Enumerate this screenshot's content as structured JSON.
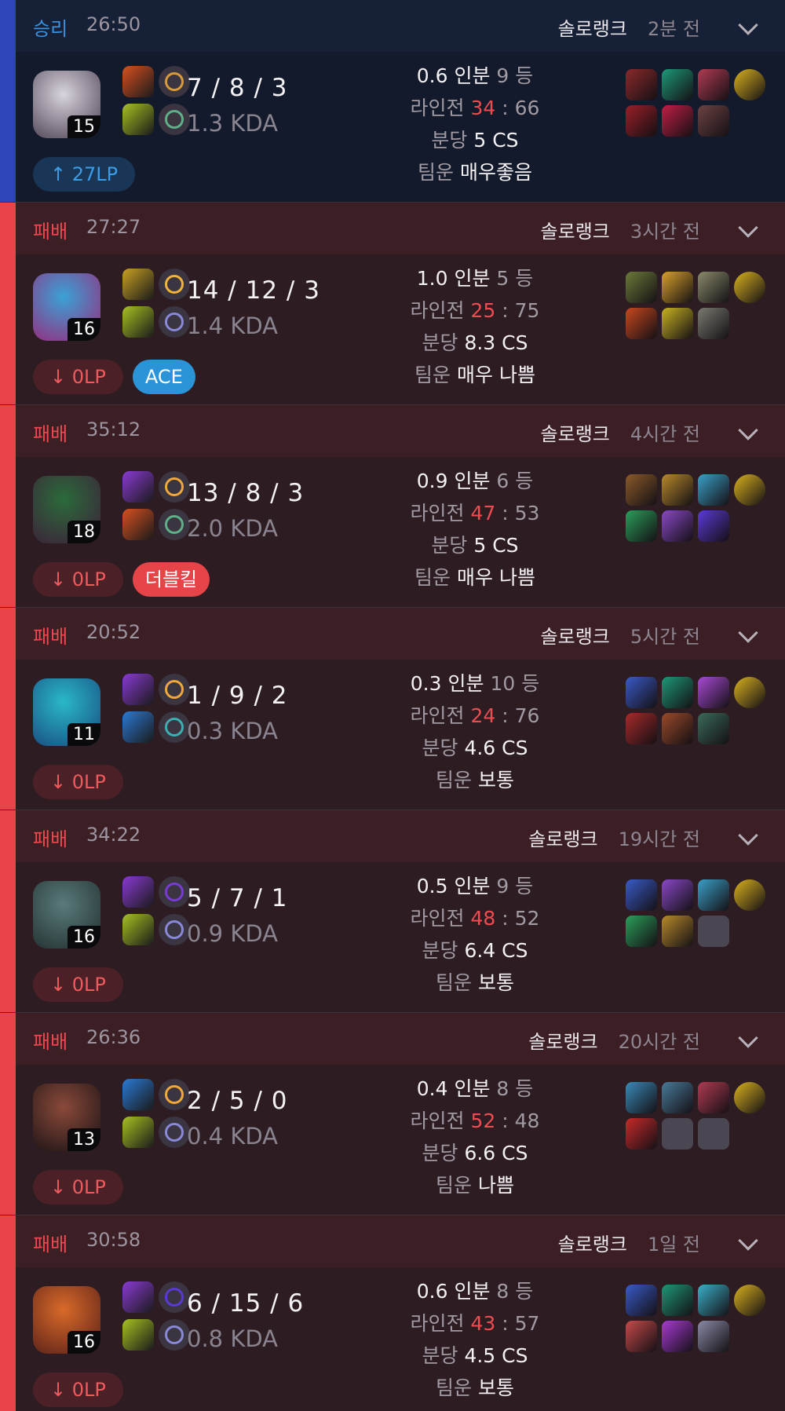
{
  "labels": {
    "kill_part_suffix": "인분",
    "rank_suffix": "등",
    "lane": "라인전",
    "cs_prefix": "분당",
    "cs_suffix": "CS",
    "luck": "팀운",
    "kda_suffix": "KDA"
  },
  "matches": [
    {
      "result": "승리",
      "outcome": "win",
      "duration": "26:50",
      "queue": "솔로랭크",
      "ago": "2분 전",
      "level": "15",
      "kda": "7 / 8 / 3",
      "kda_ratio": "1.3 KDA",
      "lp": "↑ 27LP",
      "tag": "",
      "kp": "0.6",
      "rank": "9",
      "lane_a": "34",
      "lane_b": "66",
      "cs": "5",
      "luck": "매우좋음",
      "champ_colors": [
        "#d9d4dd",
        "#5f5666"
      ],
      "spells": [
        "#d9501f",
        "#a7c221"
      ],
      "runes": [
        "#d99a3a",
        "#5fb088"
      ],
      "items": [
        "#8c2a2a",
        "#1d9978",
        "#b23b52",
        "#d9b21f",
        "#9a1f26",
        "#c21f45",
        "#6e4242"
      ]
    },
    {
      "result": "패배",
      "outcome": "loss",
      "duration": "27:27",
      "queue": "솔로랭크",
      "ago": "3시간 전",
      "level": "16",
      "kda": "14 / 12 / 3",
      "kda_ratio": "1.4 KDA",
      "lp": "↓ 0LP",
      "tag": "ACE",
      "kp": "1.0",
      "rank": "5",
      "lane_a": "25",
      "lane_b": "75",
      "cs": "8.3",
      "luck": "매우 나쁨",
      "champ_colors": [
        "#3aa2d6",
        "#8c3a88"
      ],
      "spells": [
        "#c9a221",
        "#a7c221"
      ],
      "runes": [
        "#f0b43b",
        "#8a88d8"
      ],
      "items": [
        "#6c7a3a",
        "#d9a22a",
        "#8a8a6a",
        "#d9b21f",
        "#c9471f",
        "#c9b221",
        "#7a7a70"
      ]
    },
    {
      "result": "패배",
      "outcome": "loss",
      "duration": "35:12",
      "queue": "솔로랭크",
      "ago": "4시간 전",
      "level": "18",
      "kda": "13 / 8 / 3",
      "kda_ratio": "2.0 KDA",
      "lp": "↓ 0LP",
      "tag": "더블킬",
      "kp": "0.9",
      "rank": "6",
      "lane_a": "47",
      "lane_b": "53",
      "cs": "5",
      "luck": "매우 나쁨",
      "champ_colors": [
        "#2b6b3a",
        "#3a2a3a"
      ],
      "spells": [
        "#8a3ad6",
        "#d9501f"
      ],
      "runes": [
        "#f0a83b",
        "#5fb088"
      ],
      "items": [
        "#8a5a2a",
        "#b88a2a",
        "#3aa0c8",
        "#d9b21f",
        "#2aa05a",
        "#8a48c8",
        "#5a3ad6"
      ]
    },
    {
      "result": "패배",
      "outcome": "loss",
      "duration": "20:52",
      "queue": "솔로랭크",
      "ago": "5시간 전",
      "level": "11",
      "kda": "1 / 9 / 2",
      "kda_ratio": "0.3 KDA",
      "lp": "↓ 0LP",
      "tag": "",
      "kp": "0.3",
      "rank": "10",
      "lane_a": "24",
      "lane_b": "76",
      "cs": "4.6",
      "luck": "보통",
      "champ_colors": [
        "#2ab8c8",
        "#1a5a8a"
      ],
      "spells": [
        "#8a3ad6",
        "#2a7ad6"
      ],
      "runes": [
        "#f0a83b",
        "#3ab0b0"
      ],
      "items": [
        "#3a5ac8",
        "#1d9978",
        "#a84ad6",
        "#d9b21f",
        "#a82a2a",
        "#9a4a2a",
        "#3a6a5a"
      ]
    },
    {
      "result": "패배",
      "outcome": "loss",
      "duration": "34:22",
      "queue": "솔로랭크",
      "ago": "19시간 전",
      "level": "16",
      "kda": "5 / 7 / 1",
      "kda_ratio": "0.9 KDA",
      "lp": "↓ 0LP",
      "tag": "",
      "kp": "0.5",
      "rank": "9",
      "lane_a": "48",
      "lane_b": "52",
      "cs": "6.4",
      "luck": "보통",
      "champ_colors": [
        "#5a7a7a",
        "#2a3a3a"
      ],
      "spells": [
        "#8a3ad6",
        "#a7c221"
      ],
      "runes": [
        "#7a3ad6",
        "#8a88d8"
      ],
      "items": [
        "#3a5ac8",
        "#8a48c8",
        "#3aa0c8",
        "#d9b21f",
        "#2aa05a",
        "#b88a2a",
        ""
      ]
    },
    {
      "result": "패배",
      "outcome": "loss",
      "duration": "26:36",
      "queue": "솔로랭크",
      "ago": "20시간 전",
      "level": "13",
      "kda": "2 / 5 / 0",
      "kda_ratio": "0.4 KDA",
      "lp": "↓ 0LP",
      "tag": "",
      "kp": "0.4",
      "rank": "8",
      "lane_a": "52",
      "lane_b": "48",
      "cs": "6.6",
      "luck": "나쁨",
      "champ_colors": [
        "#8a4a3a",
        "#2a1a1a"
      ],
      "spells": [
        "#2a7ad6",
        "#a7c221"
      ],
      "runes": [
        "#f0a83b",
        "#8a88d8"
      ],
      "items": [
        "#3a8ab8",
        "#4a7a9a",
        "#b23b52",
        "#d9b21f",
        "#c82a2a",
        "",
        ""
      ]
    },
    {
      "result": "패배",
      "outcome": "loss",
      "duration": "30:58",
      "queue": "솔로랭크",
      "ago": "1일 전",
      "level": "16",
      "kda": "6 / 15 / 6",
      "kda_ratio": "0.8 KDA",
      "lp": "↓ 0LP",
      "tag": "",
      "kp": "0.6",
      "rank": "8",
      "lane_a": "43",
      "lane_b": "57",
      "cs": "4.5",
      "luck": "보통",
      "champ_colors": [
        "#d96a2a",
        "#6a2a1a"
      ],
      "spells": [
        "#8a3ad6",
        "#a7c221"
      ],
      "runes": [
        "#5a3ad6",
        "#8a88d8"
      ],
      "items": [
        "#3a5ac8",
        "#1d9978",
        "#3ab0c8",
        "#d9b21f",
        "#c84a4a",
        "#a83ad6",
        "#8a8aa8"
      ]
    }
  ]
}
